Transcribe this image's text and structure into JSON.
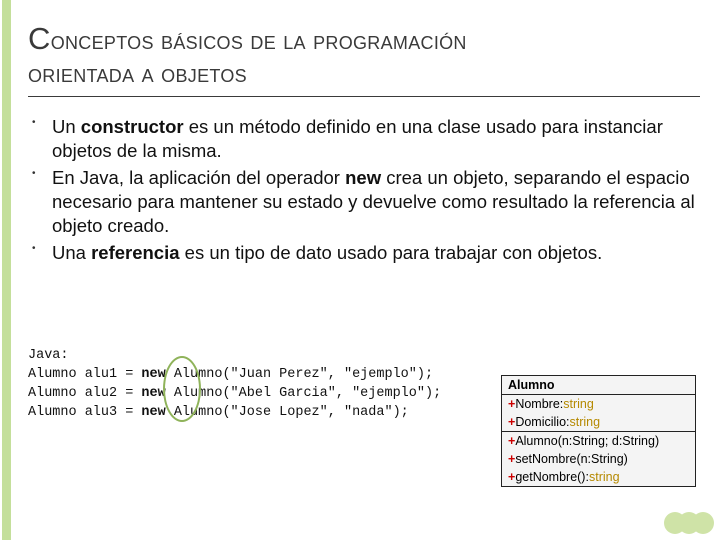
{
  "title_line1_first": "C",
  "title_line1_rest": "onceptos básicos de la programación",
  "title_line2": "orientada a objetos",
  "bullets": [
    {
      "pre": "Un ",
      "bold": "constructor",
      "post": " es un método definido en una clase usado para instanciar objetos de la misma."
    },
    {
      "pre": "En Java, la aplicación del operador ",
      "bold": "new",
      "post": " crea un objeto, separando el espacio necesario para mantener su estado y devuelve como resultado la referencia al objeto creado."
    },
    {
      "pre": "Una ",
      "bold": "referencia",
      "post": " es un tipo de dato usado para trabajar con objetos."
    }
  ],
  "code": {
    "label": "Java:",
    "lines": [
      {
        "lhs": "Alumno alu1 = ",
        "kw": "new",
        "rhs": " Alumno(\"Juan Perez\", \"ejemplo\");"
      },
      {
        "lhs": "Alumno alu2 = ",
        "kw": "new",
        "rhs": " Alumno(\"Abel Garcia\", \"ejemplo\");"
      },
      {
        "lhs": "Alumno alu3 = ",
        "kw": "new",
        "rhs": " Alumno(\"Jose Lopez\", \"nada\");"
      }
    ]
  },
  "uml": {
    "class_name": "Alumno",
    "attrs": [
      {
        "name": "Nombre",
        "type": "string"
      },
      {
        "name": "Domicilio",
        "type": "string"
      }
    ],
    "ops": [
      {
        "sig": "Alumno(n:String; d:String)",
        "ret": ""
      },
      {
        "sig": "setNombre(n:String)",
        "ret": ""
      },
      {
        "sig": "getNombre()",
        "ret": "string"
      }
    ]
  }
}
